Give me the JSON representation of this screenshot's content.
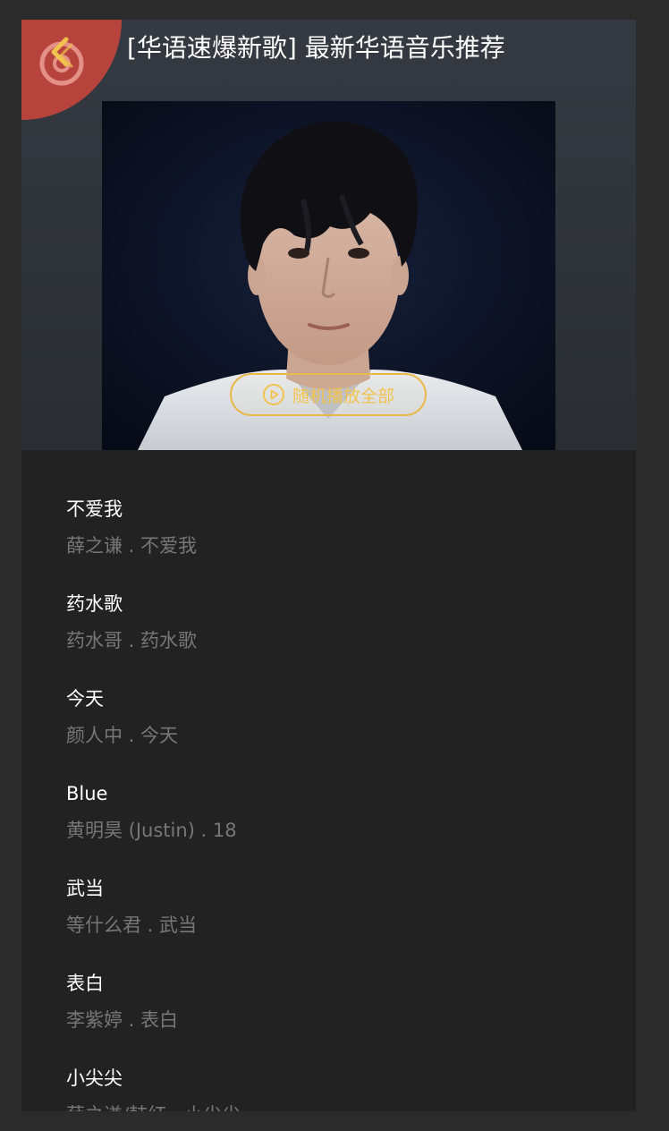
{
  "header": {
    "title": "[华语速爆新歌] 最新华语音乐推荐",
    "play_all_label": "随机播放全部",
    "back_icon": "chevron-left-icon"
  },
  "colors": {
    "accent": "#f2c24f",
    "badge": "#b7433d",
    "background": "#222222",
    "subtext": "#777777"
  },
  "songs": [
    {
      "title": "不爱我",
      "subtitle": "薛之谦 . 不爱我"
    },
    {
      "title": "药水歌",
      "subtitle": "药水哥 . 药水歌"
    },
    {
      "title": "今天",
      "subtitle": "颜人中 . 今天"
    },
    {
      "title": "Blue",
      "subtitle": "黄明昊 (Justin) . 18"
    },
    {
      "title": "武当",
      "subtitle": "等什么君 . 武当"
    },
    {
      "title": "表白",
      "subtitle": "李紫婷 . 表白"
    },
    {
      "title": "小尖尖",
      "subtitle": "薛之谦/韩红 . 小尖尖"
    }
  ]
}
